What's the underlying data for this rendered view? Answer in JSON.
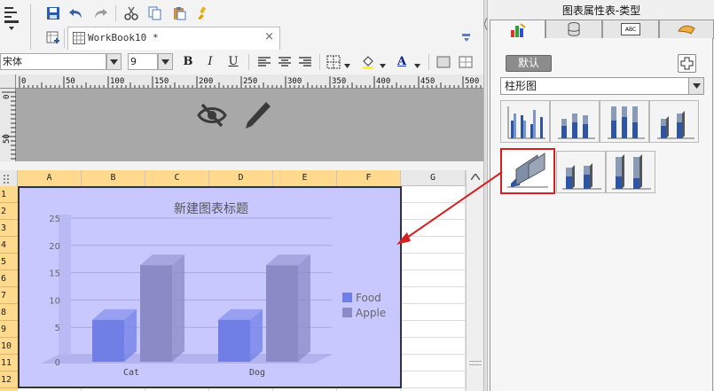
{
  "document": {
    "tab_title": "WorkBook10 *",
    "close_glyph": "×"
  },
  "format": {
    "font_name": "宋体",
    "font_size": "9",
    "bold": "B",
    "italic": "I",
    "underline": "U",
    "font_color_letter": "A"
  },
  "ruler": {
    "top_ticks": [
      "0",
      "50",
      "100",
      "150",
      "200",
      "250",
      "300",
      "350",
      "400",
      "450",
      "500"
    ],
    "left_ticks": [
      "0",
      "50"
    ]
  },
  "sheet": {
    "columns": [
      "A",
      "B",
      "C",
      "D",
      "E",
      "F",
      "G"
    ],
    "rows": [
      "1",
      "2",
      "3",
      "4",
      "5",
      "6",
      "7",
      "8",
      "9",
      "10",
      "11",
      "12"
    ]
  },
  "chart_data": {
    "type": "bar",
    "title": "新建图表标题",
    "categories": [
      "Cat",
      "Dog"
    ],
    "series": [
      {
        "name": "Food",
        "values": [
          8,
          8
        ]
      },
      {
        "name": "Apple",
        "values": [
          18,
          18
        ]
      }
    ],
    "ylim": [
      0,
      25
    ],
    "yticks": [
      "0",
      "5",
      "10",
      "15",
      "20",
      "25"
    ],
    "legend": "right",
    "grid": true,
    "colors": {
      "Food": "#6f7fe6",
      "Apple": "#8a8ac6"
    }
  },
  "panel": {
    "title": "图表属性表-类型",
    "default_button": "默认",
    "chart_type_select": "柱形图",
    "tabs": [
      "type-tab",
      "data-tab",
      "style-tab",
      "effect-tab"
    ],
    "tab3_text": "ABC"
  },
  "colors": {
    "chart_bg": "#c8c8ff",
    "header_selected": "#ffd98e",
    "arrow": "#d42020"
  }
}
